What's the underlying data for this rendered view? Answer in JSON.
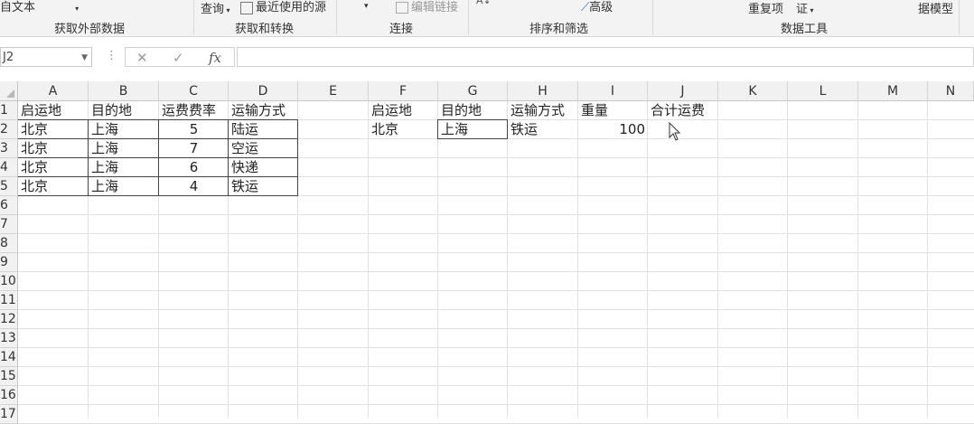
{
  "ribbon": {
    "items": [
      {
        "label": "自文本"
      },
      {
        "label": "查询"
      },
      {
        "label": "最近使用的源"
      },
      {
        "label": "编辑链接"
      },
      {
        "label": "高级"
      },
      {
        "label": "重复项"
      },
      {
        "label": "证"
      },
      {
        "label": "据模型"
      }
    ],
    "groups": [
      {
        "label": "获取外部数据"
      },
      {
        "label": "获取和转换"
      },
      {
        "label": "连接"
      },
      {
        "label": "排序和筛选"
      },
      {
        "label": "数据工具"
      }
    ]
  },
  "formula_bar": {
    "name_box": "J2",
    "cancel_symbol": "✕",
    "enter_symbol": "✓",
    "fx_symbol": "fx",
    "formula": ""
  },
  "sheet": {
    "columns": [
      "A",
      "B",
      "C",
      "D",
      "E",
      "F",
      "G",
      "H",
      "I",
      "J",
      "K",
      "L",
      "M",
      "N"
    ],
    "rows": [
      "1",
      "2",
      "3",
      "4",
      "5",
      "6",
      "7",
      "8",
      "9",
      "10",
      "11",
      "12",
      "13",
      "14",
      "15",
      "16",
      "17"
    ],
    "left_table": {
      "headers": [
        "启运地",
        "目的地",
        "运费费率",
        "运输方式"
      ],
      "rows": [
        [
          "北京",
          "上海",
          "5",
          "陆运"
        ],
        [
          "北京",
          "上海",
          "7",
          "空运"
        ],
        [
          "北京",
          "上海",
          "6",
          "快递"
        ],
        [
          "北京",
          "上海",
          "4",
          "铁运"
        ]
      ]
    },
    "right_table": {
      "headers": [
        "启运地",
        "目的地",
        "运输方式",
        "重量",
        "合计运费"
      ],
      "row": [
        "北京",
        "上海",
        "铁运",
        "100",
        ""
      ]
    }
  }
}
